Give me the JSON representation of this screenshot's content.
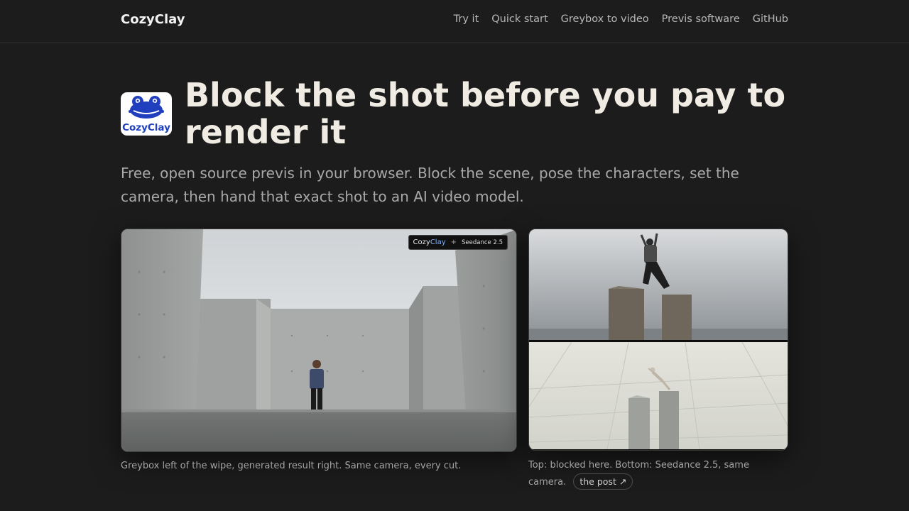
{
  "header": {
    "brand": "CozyClay",
    "nav": [
      "Try it",
      "Quick start",
      "Greybox to video",
      "Previs software",
      "GitHub"
    ]
  },
  "hero": {
    "logo_text": "CozyClay",
    "title": "Block the shot before you pay to render it",
    "lead": "Free, open source previs in your browser. Block the scene, pose the characters, set the camera, then hand that exact shot to an AI video model."
  },
  "media": {
    "left": {
      "badge_brand_a": "Cozy",
      "badge_brand_b": "Clay",
      "badge_plus": "+",
      "badge_model": "Seedance 2.5",
      "caption": "Greybox left of the wipe, generated result right. Same camera, every cut."
    },
    "right": {
      "caption": "Top: blocked here. Bottom: Seedance 2.5, same camera.",
      "link_label": "the post ↗"
    }
  },
  "colors": {
    "background": "#1c1c1c",
    "headline": "#f0ece4",
    "muted": "#a9a9a9",
    "logo_blue": "#1f3fbf"
  },
  "icons": {
    "logo": "frog-logo-icon"
  }
}
